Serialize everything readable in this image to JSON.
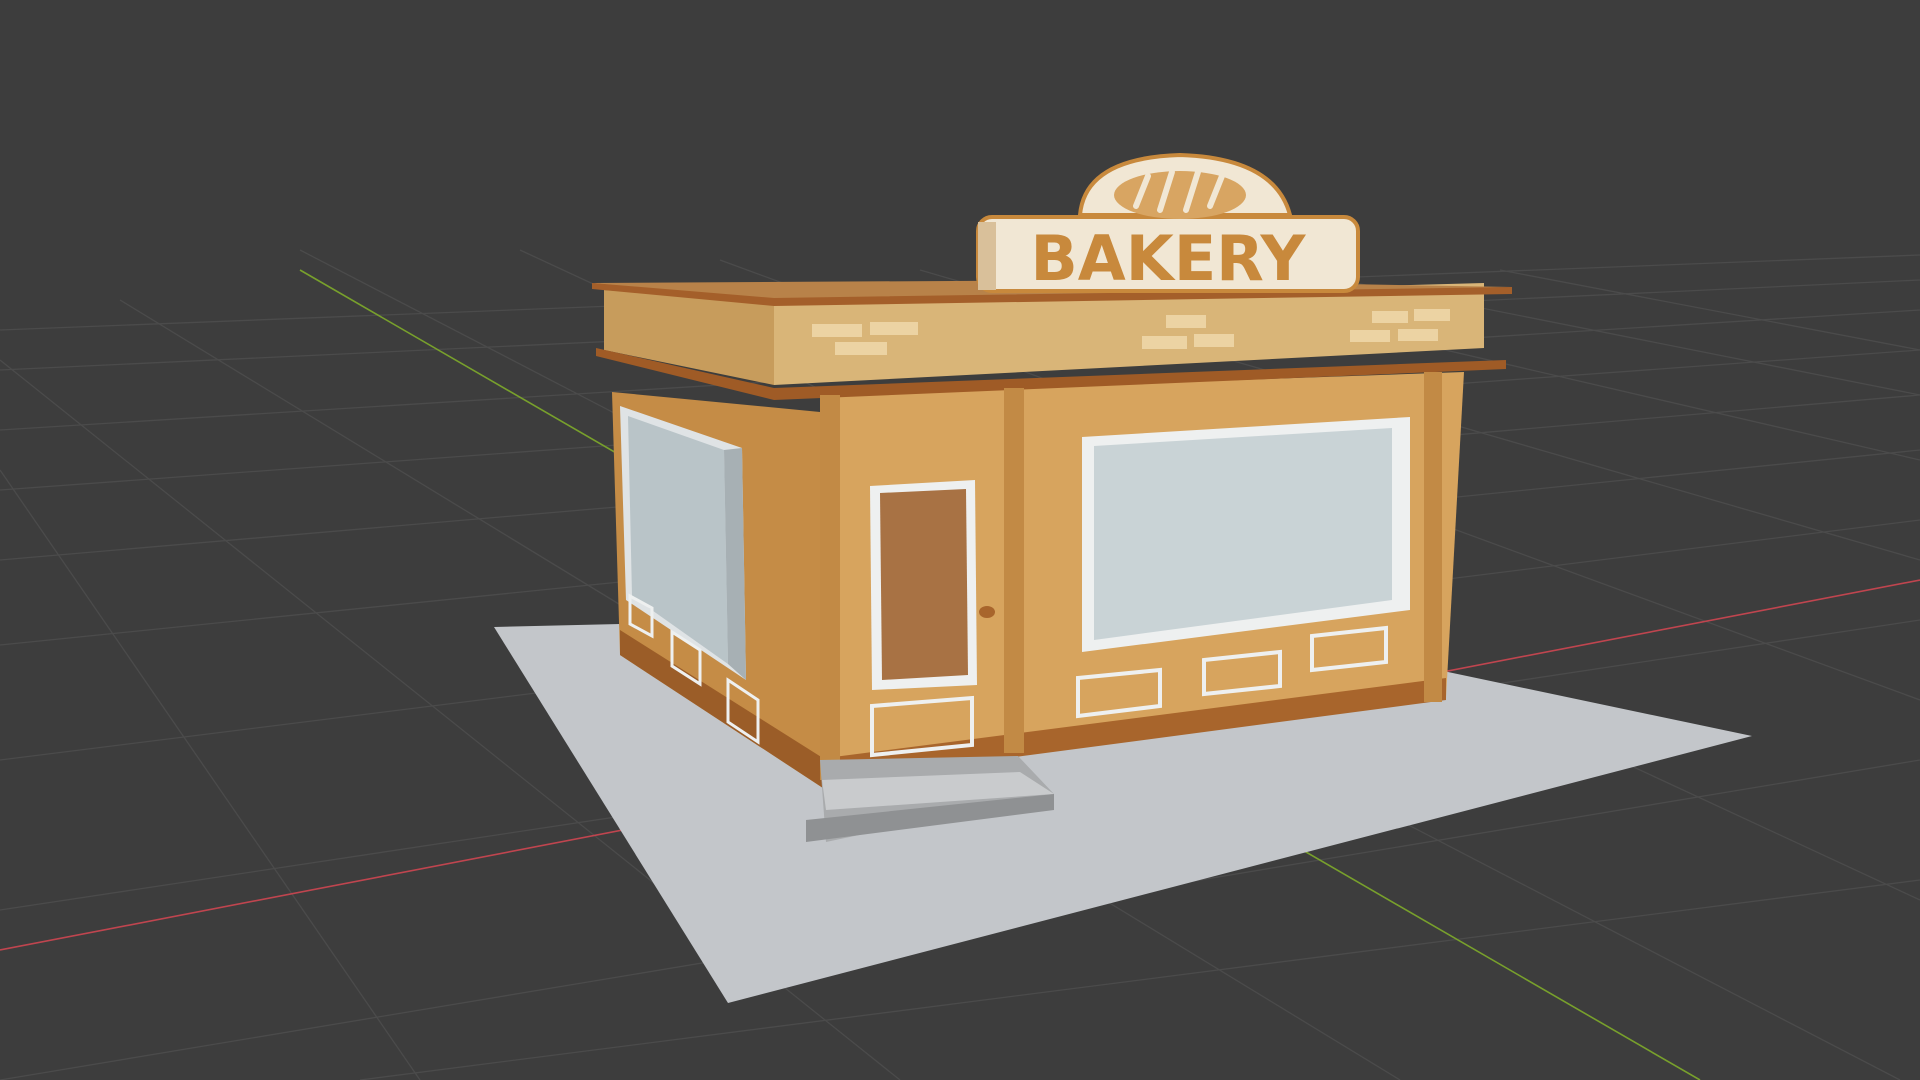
{
  "viewport": {
    "background": "#3d3d3d",
    "grid_color": "#4a4a4a",
    "x_axis_color": "#c0454f",
    "y_axis_color": "#78a02c"
  },
  "model": {
    "sign_text": "BAKERY",
    "sign_icon": "bread-icon",
    "colors": {
      "wall": "#d7a45e",
      "wall_dark": "#b98442",
      "trim": "#a8652c",
      "roof": "#d9b578",
      "sign_bg": "#f1e7d4",
      "sign_text": "#c8893c",
      "glass": "#c9d3d6",
      "door": "#a87244",
      "ground": "#c3c6ca",
      "steps": "#a9abad"
    }
  }
}
